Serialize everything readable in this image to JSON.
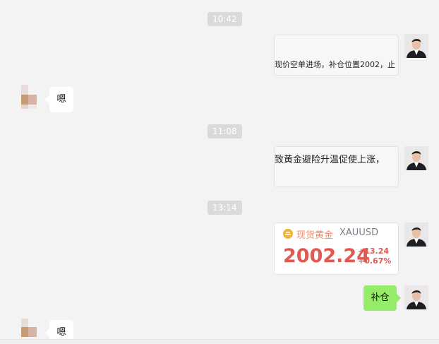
{
  "messages": {
    "time1": "10:42",
    "msg1_text": "现价空单进场，补仓位置2002，止",
    "reply1_text": "嗯",
    "time2": "11:08",
    "msg2_text": "致黄金避险升温促使上涨，",
    "time3": "13:14",
    "quote": {
      "name": "现货黄金",
      "symbol": "XAUUSD",
      "price": "2002.24",
      "change": "+13.24",
      "percent": "+0.67%",
      "accent_color": "#e05a52",
      "icon": "gold-coin-icon"
    },
    "msg3_text": "补仓",
    "reply2_text": "嗯"
  },
  "colors": {
    "self_bubble": "#95ec69",
    "other_bubble": "#ffffff",
    "background": "#f3f3f3"
  }
}
